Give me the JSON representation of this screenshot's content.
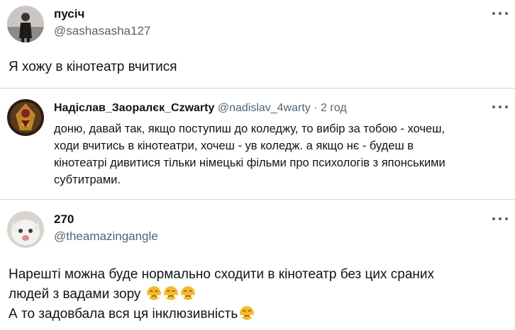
{
  "tweet1": {
    "name": "пусіч",
    "handle": "@sashasasha127",
    "text": "Я хожу в кінотеатр вчитися"
  },
  "quote": {
    "name": "Надіслав_Заоралєк_Czwarty",
    "handle": "@nadislav_4warty",
    "separator": "·",
    "time": "2 год",
    "lines": [
      "доню, давай так, якщо поступиш до коледжу, то вибір за тобою - хочеш,",
      "ходи вчитись в кінотеатри, хочеш - ув коледж. а якщо нє - будеш в",
      "кінотеатрі дивитися тільки німецькі фільми про психологів з японськими",
      "субтитрами."
    ]
  },
  "tweet2": {
    "name": "270",
    "handle": "@theamazingangle",
    "line1": "Нарешті можна буде нормально сходити в кінотеатр без цих сраних",
    "line2": "людей з вадами зору",
    "line3": "А то задовбала вся ця інклюзивність"
  },
  "icons": {
    "more": "more-horizontal-icon",
    "emoji": "face-with-steam-from-nose-emoji"
  },
  "colors": {
    "text": "#0f1419",
    "secondary": "#536471",
    "border": "#cfd9de",
    "emoji": "#f5b82e"
  }
}
